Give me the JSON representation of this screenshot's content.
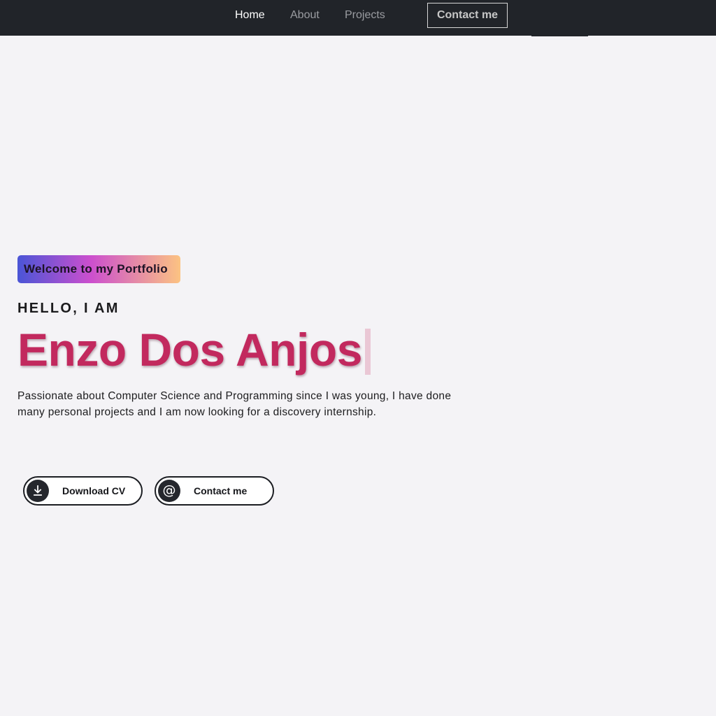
{
  "nav": {
    "home": "Home",
    "about": "About",
    "projects": "Projects",
    "contact": "Contact me"
  },
  "hero": {
    "badge": "Welcome to my Portfolio",
    "greeting": "HELLO, I AM",
    "name": "Enzo Dos Anjos",
    "description": "Passionate about Computer Science and Programming since I was young, I have done many personal projects and I am now looking for a discovery internship."
  },
  "buttons": {
    "download_cv": "Download CV",
    "contact": "Contact me",
    "download_icon": "download-icon",
    "contact_icon": "at-sign-icon"
  },
  "colors": {
    "navbar_bg": "#212429",
    "page_bg": "#f4f3f6",
    "accent_name": "#c2295e",
    "badge_gradient": [
      "#4a55d6",
      "#cc4fce",
      "#fcc382"
    ]
  }
}
